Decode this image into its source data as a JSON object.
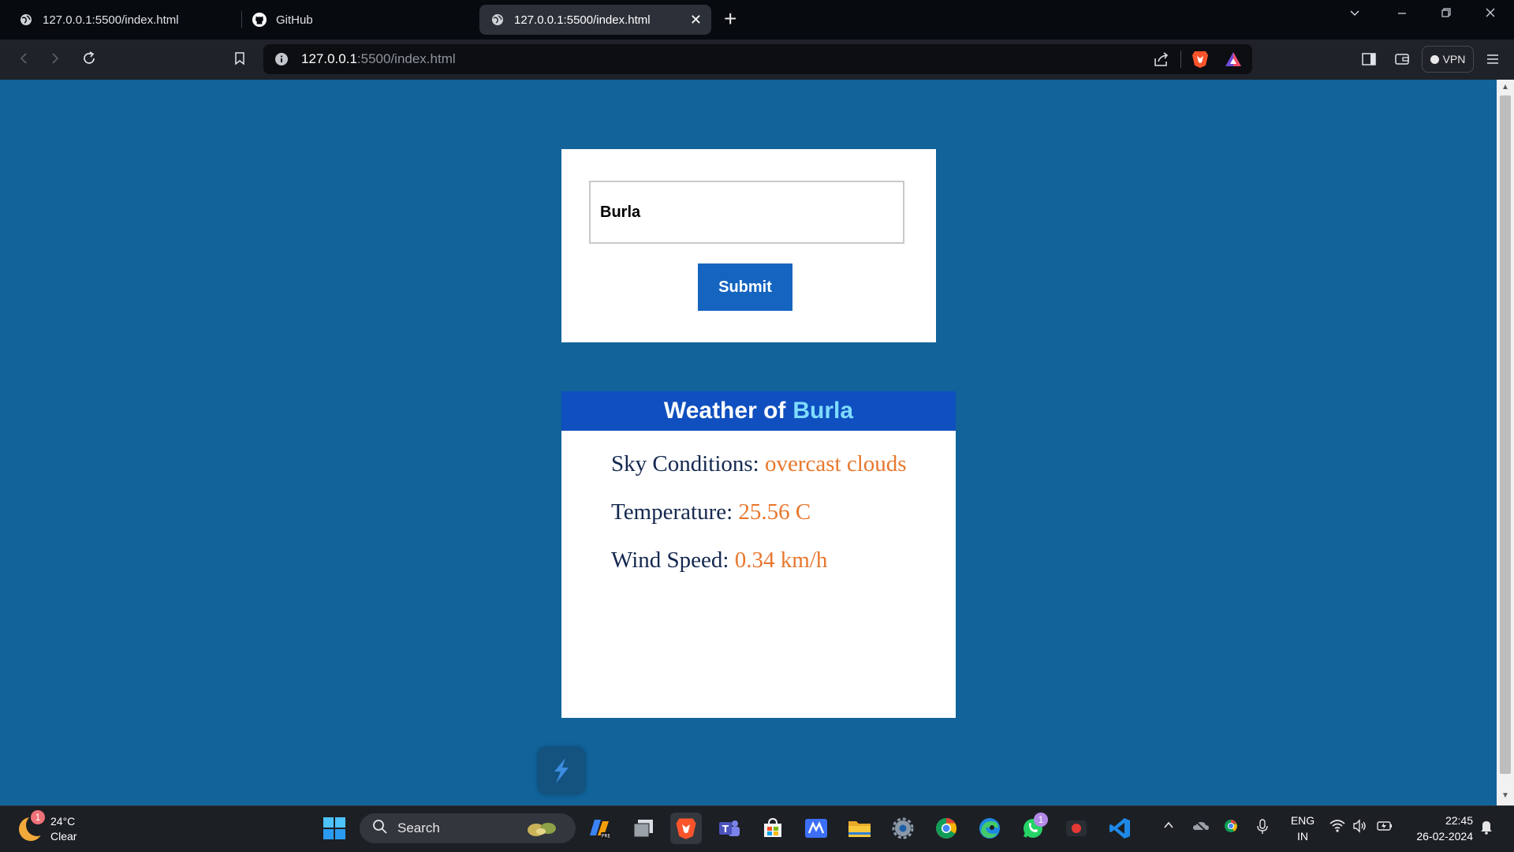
{
  "browser": {
    "tabs": [
      {
        "title": "127.0.0.1:5500/index.html",
        "active": false
      },
      {
        "title": "GitHub",
        "active": false
      },
      {
        "title": "127.0.0.1:5500/index.html",
        "active": true
      }
    ],
    "close_glyph": "✕",
    "new_tab_glyph": "+",
    "url_host": "127.0.0.1",
    "url_rest": ":5500/index.html",
    "vpn_label": "VPN",
    "accent_brave": "#fb542b"
  },
  "page": {
    "search": {
      "value": "Burla",
      "placeholder": ""
    },
    "submit_label": "Submit",
    "result": {
      "title_prefix": "Weather of",
      "city": "Burla",
      "sky_label": "Sky Conditions:",
      "sky_value": "overcast clouds",
      "temp_label": "Temperature:",
      "temp_value": "25.56 C",
      "wind_label": "Wind Speed:",
      "wind_value": "0.34 km/h"
    },
    "colors": {
      "background": "#11639a",
      "button": "#1565c0",
      "header": "#0f4fbf",
      "value": "#e8772e"
    }
  },
  "taskbar": {
    "weather_temp": "24°C",
    "weather_desc": "Clear",
    "weather_badge": "1",
    "search_label": "Search",
    "whatsapp_badge": "1",
    "lang_line1": "ENG",
    "lang_line2": "IN",
    "time": "22:45",
    "date": "26-02-2024"
  }
}
